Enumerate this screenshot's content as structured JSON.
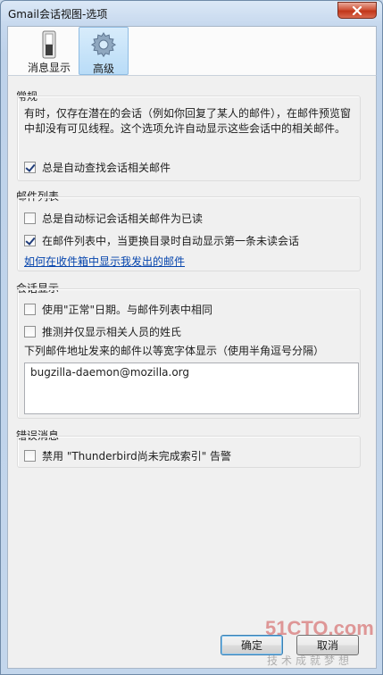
{
  "window": {
    "title": "Gmail会话视图-选项"
  },
  "toolbar": {
    "tabs": [
      {
        "label": "消息显示",
        "icon": "switch-icon"
      },
      {
        "label": "高级",
        "icon": "gear-icon",
        "selected": true
      }
    ]
  },
  "general": {
    "title": "常规",
    "description": "有时，仅存在潜在的会话（例如你回复了某人的邮件），在邮件预览窗中却没有可见线程。这个选项允许自动显示这些会话中的相关邮件。",
    "auto_find": {
      "label": "总是自动查找会话相关邮件",
      "checked": true
    }
  },
  "mail_list": {
    "title": "邮件列表",
    "auto_mark": {
      "label": "总是自动标记会话相关邮件为已读",
      "checked": false
    },
    "auto_show_first": {
      "label": "在邮件列表中，当更换目录时自动显示第一条未读会话",
      "checked": true
    },
    "link": "如何在收件箱中显示我发出的邮件"
  },
  "conversation_display": {
    "title": "会话显示",
    "normal_date": {
      "label": "使用\"正常\"日期。与邮件列表中相同",
      "checked": false
    },
    "guess_names": {
      "label": "推测并仅显示相关人员的姓氏",
      "checked": false
    },
    "monospace_label": "下列邮件地址发来的邮件以等宽字体显示（使用半角逗号分隔）",
    "monospace_value": "bugzilla-daemon@mozilla.org"
  },
  "errors": {
    "title": "错误消息",
    "disable_warning": {
      "label": "禁用 \"Thunderbird尚未完成索引\" 告警",
      "checked": false
    }
  },
  "buttons": {
    "ok": "确定",
    "cancel": "取消"
  },
  "watermark": {
    "brand": "51CTO.com",
    "slogan": "技术成就梦想"
  }
}
